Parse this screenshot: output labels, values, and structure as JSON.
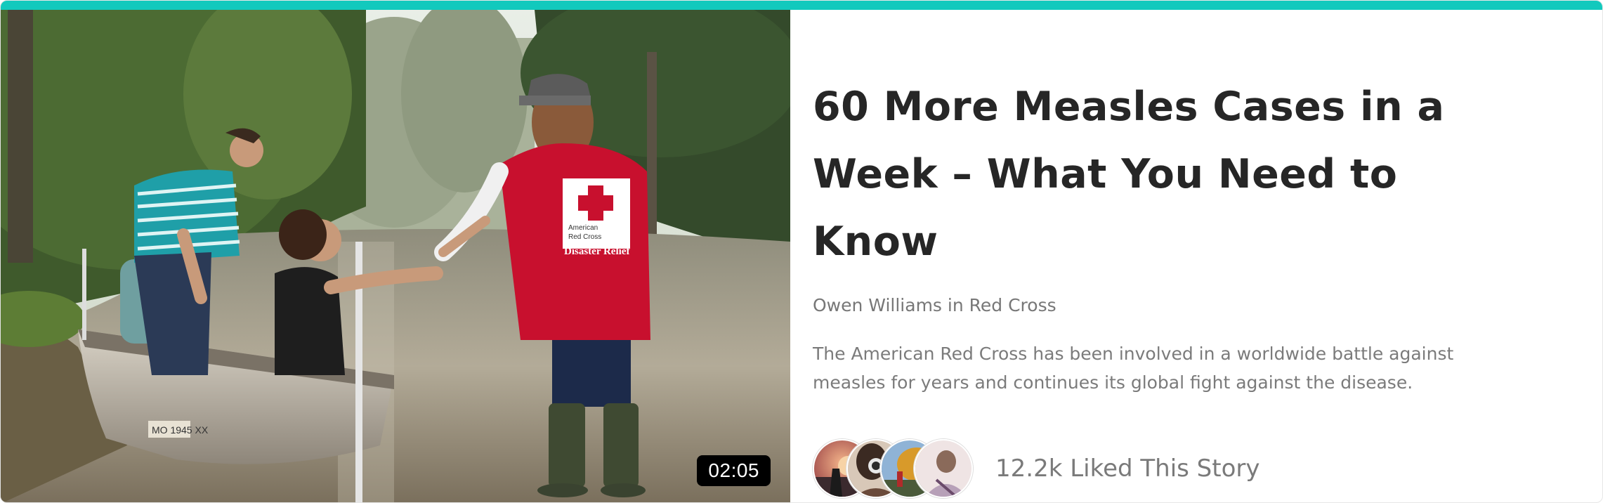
{
  "article": {
    "title": "60 More Measles Cases in a Week – What You Need to Know",
    "author": "Owen Williams",
    "in_label": "in",
    "category": "Red Cross",
    "excerpt": "The American Red Cross has been involved in a worldwide battle against measles for years and continues its global fight against the disease.",
    "likes_text": "12.2k Liked This Story"
  },
  "video": {
    "duration": "02:05",
    "vest_text_1": "American",
    "vest_text_2": "Red Cross",
    "vest_text_3": "Disaster Relief",
    "boat_number": "MO 1945 XX"
  },
  "colors": {
    "accent": "#12c9bd",
    "title": "#262626",
    "muted": "#7b7b7b",
    "red_cross": "#c8102e"
  },
  "avatars": [
    {
      "icon": "avatar-sunset-photographer"
    },
    {
      "icon": "avatar-woman-camera"
    },
    {
      "icon": "avatar-autumn-tree"
    },
    {
      "icon": "avatar-woman-portrait"
    }
  ]
}
